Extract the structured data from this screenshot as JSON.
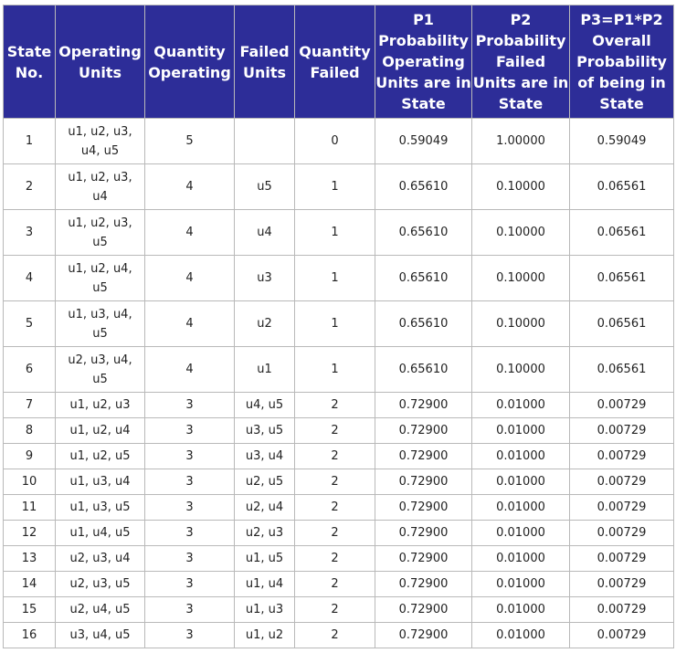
{
  "table": {
    "headers": [
      "State No.",
      "Operating Units",
      "Quantity Operating",
      "Failed Units",
      "Quantity Failed",
      "P1 Probability Operating Units are in State",
      "P2 Probability Failed Units are in State",
      "P3=P1*P2 Overall Probability of being in State"
    ],
    "rows": [
      [
        "1",
        "u1, u2, u3, u4, u5",
        "5",
        "",
        "0",
        "0.59049",
        "1.00000",
        "0.59049"
      ],
      [
        "2",
        "u1, u2, u3, u4",
        "4",
        "u5",
        "1",
        "0.65610",
        "0.10000",
        "0.06561"
      ],
      [
        "3",
        "u1, u2, u3, u5",
        "4",
        "u4",
        "1",
        "0.65610",
        "0.10000",
        "0.06561"
      ],
      [
        "4",
        "u1, u2, u4, u5",
        "4",
        "u3",
        "1",
        "0.65610",
        "0.10000",
        "0.06561"
      ],
      [
        "5",
        "u1, u3, u4, u5",
        "4",
        "u2",
        "1",
        "0.65610",
        "0.10000",
        "0.06561"
      ],
      [
        "6",
        "u2, u3, u4, u5",
        "4",
        "u1",
        "1",
        "0.65610",
        "0.10000",
        "0.06561"
      ],
      [
        "7",
        "u1, u2, u3",
        "3",
        "u4, u5",
        "2",
        "0.72900",
        "0.01000",
        "0.00729"
      ],
      [
        "8",
        "u1, u2, u4",
        "3",
        "u3, u5",
        "2",
        "0.72900",
        "0.01000",
        "0.00729"
      ],
      [
        "9",
        "u1, u2, u5",
        "3",
        "u3, u4",
        "2",
        "0.72900",
        "0.01000",
        "0.00729"
      ],
      [
        "10",
        "u1, u3, u4",
        "3",
        "u2, u5",
        "2",
        "0.72900",
        "0.01000",
        "0.00729"
      ],
      [
        "11",
        "u1, u3, u5",
        "3",
        "u2, u4",
        "2",
        "0.72900",
        "0.01000",
        "0.00729"
      ],
      [
        "12",
        "u1, u4, u5",
        "3",
        "u2, u3",
        "2",
        "0.72900",
        "0.01000",
        "0.00729"
      ],
      [
        "13",
        "u2, u3, u4",
        "3",
        "u1, u5",
        "2",
        "0.72900",
        "0.01000",
        "0.00729"
      ],
      [
        "14",
        "u2, u3, u5",
        "3",
        "u1, u4",
        "2",
        "0.72900",
        "0.01000",
        "0.00729"
      ],
      [
        "15",
        "u2, u4, u5",
        "3",
        "u1, u3",
        "2",
        "0.72900",
        "0.01000",
        "0.00729"
      ],
      [
        "16",
        "u3, u4, u5",
        "3",
        "u1, u2",
        "2",
        "0.72900",
        "0.01000",
        "0.00729"
      ]
    ]
  },
  "colors": {
    "header_bg": "#2d2d98",
    "header_text": "#ffffff",
    "border": "#b9b9b9"
  }
}
